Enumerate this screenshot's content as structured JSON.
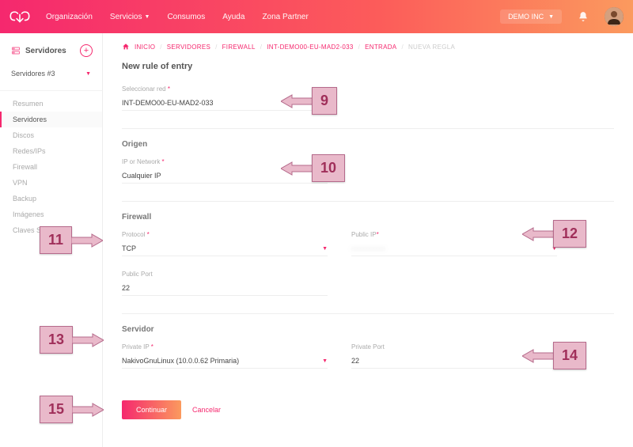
{
  "colors": {
    "accent": "#f5286e",
    "gradient_start": "#f5286e",
    "gradient_end": "#fb9a5e"
  },
  "topnav": {
    "items": [
      {
        "label": "Organización",
        "dropdown": false
      },
      {
        "label": "Servicios",
        "dropdown": true
      },
      {
        "label": "Consumos",
        "dropdown": false
      },
      {
        "label": "Ayuda",
        "dropdown": false
      },
      {
        "label": "Zona Partner",
        "dropdown": false
      }
    ],
    "org_label": "DEMO INC"
  },
  "sidebar": {
    "title": "Servidores",
    "subtitle": "Servidores #3",
    "items": [
      {
        "label": "Resumen",
        "active": false
      },
      {
        "label": "Servidores",
        "active": true
      },
      {
        "label": "Discos",
        "active": false
      },
      {
        "label": "Redes/IPs",
        "active": false
      },
      {
        "label": "Firewall",
        "active": false
      },
      {
        "label": "VPN",
        "active": false
      },
      {
        "label": "Backup",
        "active": false
      },
      {
        "label": "Imágenes",
        "active": false
      },
      {
        "label": "Claves SSH",
        "active": false
      }
    ]
  },
  "breadcrumbs": [
    {
      "label": "INICIO",
      "link": true
    },
    {
      "label": "SERVIDORES",
      "link": true
    },
    {
      "label": "FIREWALL",
      "link": true
    },
    {
      "label": "INT-DEMO00-EU-MAD2-033",
      "link": true
    },
    {
      "label": "ENTRADA",
      "link": true
    },
    {
      "label": "NUEVA REGLA",
      "link": false
    }
  ],
  "page_title": "New rule of entry",
  "form": {
    "network": {
      "label": "Seleccionar red",
      "required": true,
      "value": "INT-DEMO00-EU-MAD2-033"
    },
    "origin_section": "Origen",
    "ip_network": {
      "label": "IP or Network",
      "required": true,
      "value": "Cualquier IP"
    },
    "firewall_section": "Firewall",
    "protocol": {
      "label": "Protocol",
      "required": true,
      "value": "TCP"
    },
    "public_ip": {
      "label": "Public IP",
      "required": true,
      "value": "···········"
    },
    "public_port": {
      "label": "Public Port",
      "value": "22"
    },
    "server_section": "Servidor",
    "private_ip": {
      "label": "Private IP",
      "required": true,
      "value": "NakivoGnuLinux (10.0.0.62 Primaria)"
    },
    "private_port": {
      "label": "Private Port",
      "value": "22"
    },
    "continue_label": "Continuar",
    "cancel_label": "Cancelar"
  },
  "callouts": {
    "c9": "9",
    "c10": "10",
    "c11": "11",
    "c12": "12",
    "c13": "13",
    "c14": "14",
    "c15": "15"
  }
}
